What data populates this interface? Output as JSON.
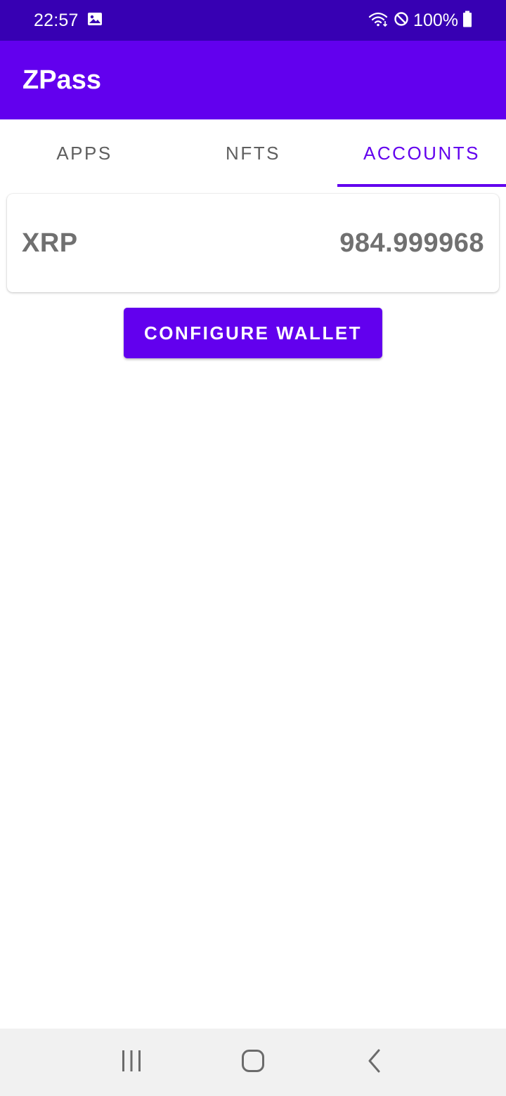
{
  "status_bar": {
    "time": "22:57",
    "battery": "100%",
    "icons": [
      "image-icon",
      "wifi-icon",
      "do-not-disturb-icon",
      "battery-icon"
    ]
  },
  "app_bar": {
    "title": "ZPass"
  },
  "tabs": [
    {
      "label": "APPS",
      "active": false
    },
    {
      "label": "NFTS",
      "active": false
    },
    {
      "label": "ACCOUNTS",
      "active": true
    }
  ],
  "accounts": [
    {
      "symbol": "XRP",
      "balance": "984.999968"
    }
  ],
  "configure_button": {
    "label": "CONFIGURE WALLET"
  },
  "colors": {
    "status_bar": "#3700b3",
    "primary": "#6200ee",
    "tab_inactive": "#5f5f5f",
    "card_text": "#707070",
    "nav_bar": "#f1f1f1"
  },
  "nav_bar": {
    "icons": [
      "recents-icon",
      "home-icon",
      "back-icon"
    ]
  }
}
